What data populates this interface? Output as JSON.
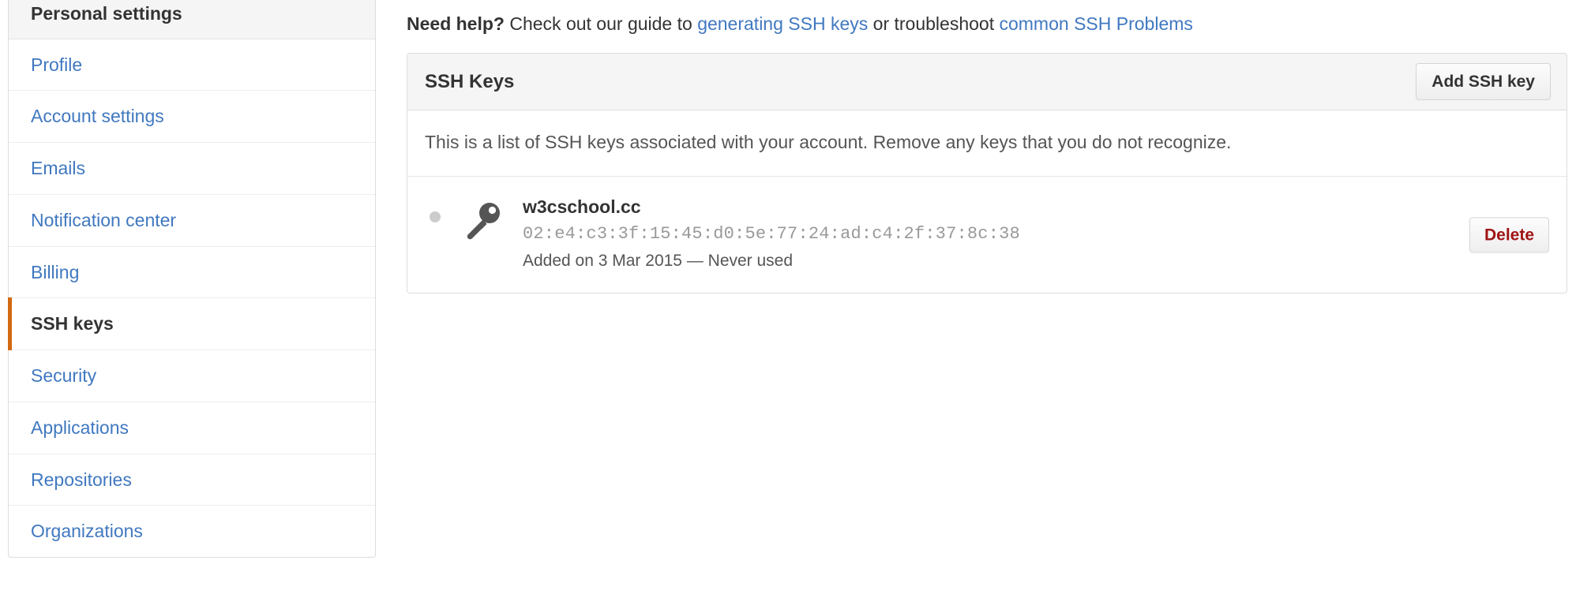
{
  "sidebar": {
    "header": "Personal settings",
    "items": [
      {
        "label": "Profile",
        "active": false
      },
      {
        "label": "Account settings",
        "active": false
      },
      {
        "label": "Emails",
        "active": false
      },
      {
        "label": "Notification center",
        "active": false
      },
      {
        "label": "Billing",
        "active": false
      },
      {
        "label": "SSH keys",
        "active": true
      },
      {
        "label": "Security",
        "active": false
      },
      {
        "label": "Applications",
        "active": false
      },
      {
        "label": "Repositories",
        "active": false
      },
      {
        "label": "Organizations",
        "active": false
      }
    ]
  },
  "help": {
    "lead": "Need help?",
    "text_1": " Check out our guide to ",
    "link_1": "generating SSH keys",
    "text_2": " or troubleshoot ",
    "link_2": "common SSH Problems"
  },
  "panel": {
    "title": "SSH Keys",
    "add_button": "Add SSH key",
    "description": "This is a list of SSH keys associated with your account. Remove any keys that you do not recognize.",
    "keys": [
      {
        "name": "w3cschool.cc",
        "fingerprint": "02:e4:c3:3f:15:45:d0:5e:77:24:ad:c4:2f:37:8c:38",
        "added": "Added on 3 Mar 2015 — Never used",
        "delete_button": "Delete",
        "status_icon": "status-dot-icon",
        "key_icon": "key-icon"
      }
    ]
  },
  "colors": {
    "link": "#4078c0",
    "active_accent": "#d26911",
    "delete_text": "#9f1414",
    "panel_border": "#dddddd",
    "header_bg": "#f5f5f5"
  }
}
